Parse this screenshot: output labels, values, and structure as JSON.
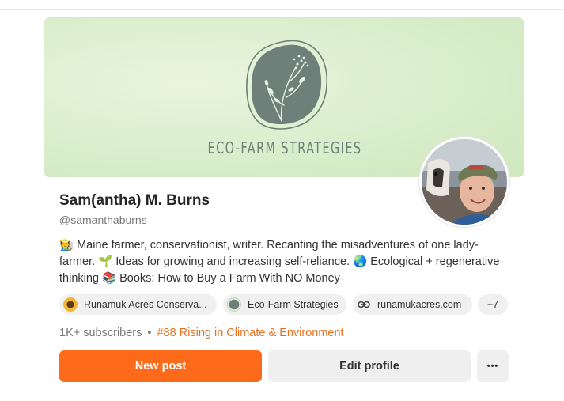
{
  "banner": {
    "title": "ECO-FARM STRATEGIES"
  },
  "profile": {
    "name": "Sam(antha) M. Burns",
    "handle": "@samanthaburns",
    "bio": {
      "part1": "Maine farmer, conservationist, writer. Recanting the misadventures of one lady-farmer.",
      "part2": "Ideas for growing and increasing self-reliance.",
      "part3": "Ecological + regenerative thinking",
      "part4": "Books: How to Buy a Farm With NO Money",
      "emoji1": "🧑‍🌾",
      "emoji2": "🌱",
      "emoji3": "🌏",
      "emoji4": "📚"
    }
  },
  "chips": [
    {
      "label": "Runamuk Acres Conserva...",
      "icon": "runamuk-logo-icon"
    },
    {
      "label": "Eco-Farm Strategies",
      "icon": "eco-farm-logo-icon"
    },
    {
      "label": "runamukacres.com",
      "icon": "link-icon"
    },
    {
      "label": "+7"
    }
  ],
  "stats": {
    "subscribers": "1K+ subscribers",
    "separator": "•",
    "rank": "#88 Rising in Climate & Environment"
  },
  "actions": {
    "new_post": "New post",
    "edit_profile": "Edit profile",
    "more": "•••"
  },
  "colors": {
    "accent": "#fd6b1a",
    "rank": "#e5711f",
    "banner_green": "#dcefcf",
    "logo_gray": "#6f7f79"
  }
}
